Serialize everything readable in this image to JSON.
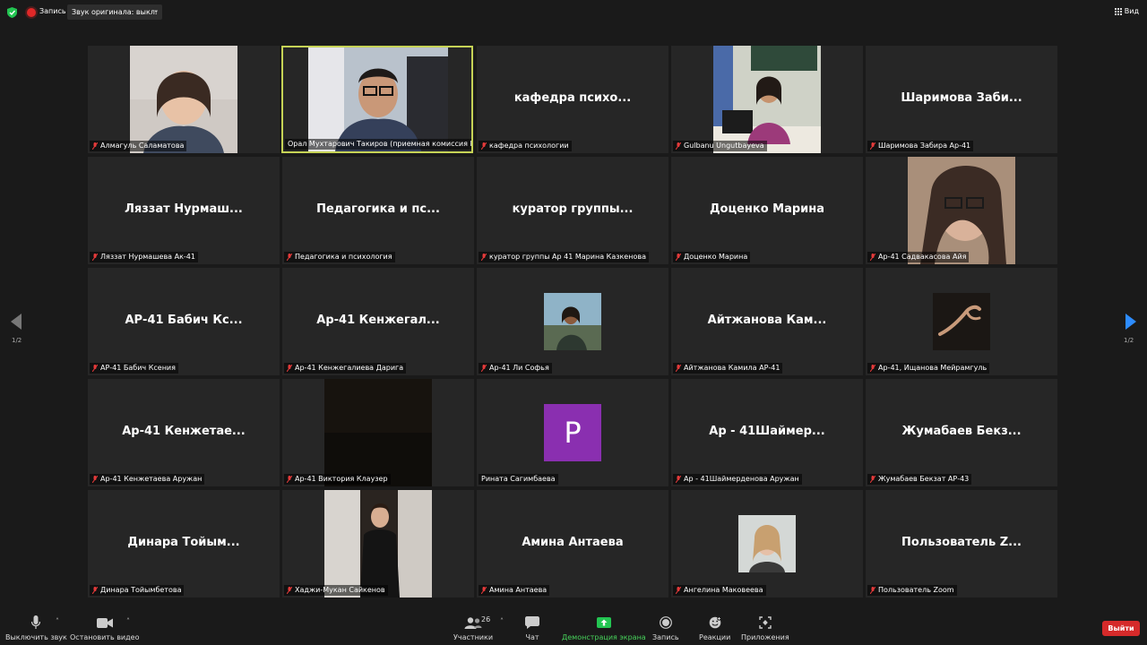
{
  "topbar": {
    "record_label": "Запись",
    "original_sound": "Звук оригинала: выкл.",
    "view_label": "Вид"
  },
  "pager": {
    "left_page": "1/2",
    "right_page": "1/2"
  },
  "tiles": [
    {
      "display": "",
      "name": "Алмагуль Саламатова"
    },
    {
      "display": "",
      "name": "Орал Мухтарович Такиров (приемная комиссия К..."
    },
    {
      "display": "кафедра психо...",
      "name": "кафедра психологии"
    },
    {
      "display": "",
      "name": "Gulbanu Ungutbayeva"
    },
    {
      "display": "Шаримова Заби...",
      "name": "Шаримова Забира Ар-41"
    },
    {
      "display": "Ляззат Нурмаш...",
      "name": "Ляззат Нурмашева Ак-41"
    },
    {
      "display": "Педагогика и пс...",
      "name": "Педагогика и психология"
    },
    {
      "display": "куратор группы...",
      "name": "куратор группы Ар 41 Марина Казкенова"
    },
    {
      "display": "Доценко Марина",
      "name": "Доценко Марина"
    },
    {
      "display": "",
      "name": "Ар-41 Садвакасова Айя"
    },
    {
      "display": "АР-41 Бабич Кс...",
      "name": "АР-41 Бабич Ксения"
    },
    {
      "display": "Ар-41 Кенжегал...",
      "name": "Ар-41 Кенжегалиева Дарига"
    },
    {
      "display": "",
      "name": "Ар-41 Ли Софья"
    },
    {
      "display": "Айтжанова Кам...",
      "name": "Айтжанова Камила АР-41"
    },
    {
      "display": "",
      "name": "Ар-41, Ищанова Мейрамгуль"
    },
    {
      "display": "Ар-41 Кенжетае...",
      "name": "Ар-41 Кенжетаева Аружан"
    },
    {
      "display": "",
      "name": "Ар-41 Виктория Клаузер"
    },
    {
      "display": "",
      "name": "Рината Сагимбаева",
      "avatar_letter": "P"
    },
    {
      "display": "Ар - 41Шаймер...",
      "name": "Ар - 41Шаймерденова Аружан"
    },
    {
      "display": "Жумабаев Бекз...",
      "name": "Жумабаев Бекзат АР-43"
    },
    {
      "display": "Динара Тойым...",
      "name": "Динара Тойымбетова"
    },
    {
      "display": "",
      "name": "Хаджи-Мукан Сайкенов"
    },
    {
      "display": "Амина Антаева",
      "name": "Амина Антаева"
    },
    {
      "display": "",
      "name": "Ангелина Маковеева"
    },
    {
      "display": "Пользователь Z...",
      "name": "Пользователь Zoom"
    }
  ],
  "toolbar": {
    "mute": "Выключить звук",
    "video": "Остановить видео",
    "participants": "Участники",
    "participants_count": "26",
    "chat": "Чат",
    "share": "Демонстрация экрана",
    "record": "Запись",
    "reactions": "Реакции",
    "apps": "Приложения",
    "leave": "Выйти"
  },
  "colors": {
    "active_speaker_border": "#c6d356",
    "share_green": "#47d35b",
    "leave_red": "#d52a2a",
    "avatar_purple": "#8a2fb0"
  }
}
